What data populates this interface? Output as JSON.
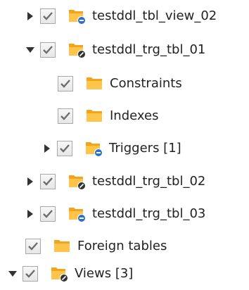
{
  "colors": {
    "folder_orange": "#f4a31c",
    "folder_light": "#ffd27a",
    "badge_blue": "#2d6fc9",
    "badge_dark": "#333333",
    "check_gray": "#6d6d6d",
    "arrow_dark": "#333333"
  },
  "tree": {
    "items": [
      {
        "label": "testddl_tbl_view_02",
        "toggle": "collapsed",
        "checked": true,
        "icon": "folder-blue-badge-icon"
      },
      {
        "label": "testddl_trg_tbl_01",
        "toggle": "expanded",
        "checked": true,
        "icon": "folder-dark-badge-icon"
      },
      {
        "label": "Constraints",
        "toggle": "none",
        "checked": true,
        "icon": "folder-icon"
      },
      {
        "label": "Indexes",
        "toggle": "none",
        "checked": true,
        "icon": "folder-icon"
      },
      {
        "label": "Triggers [1]",
        "toggle": "collapsed",
        "checked": true,
        "icon": "folder-blue-badge-icon"
      },
      {
        "label": "testddl_trg_tbl_02",
        "toggle": "collapsed",
        "checked": true,
        "icon": "folder-dark-badge-icon"
      },
      {
        "label": "testddl_trg_tbl_03",
        "toggle": "collapsed",
        "checked": true,
        "icon": "folder-blue-badge-icon"
      },
      {
        "label": "Foreign tables",
        "toggle": "none",
        "checked": true,
        "icon": "folder-icon"
      },
      {
        "label": "Views [3]",
        "toggle": "expanded",
        "checked": true,
        "icon": "folder-dark-badge-icon"
      }
    ]
  }
}
